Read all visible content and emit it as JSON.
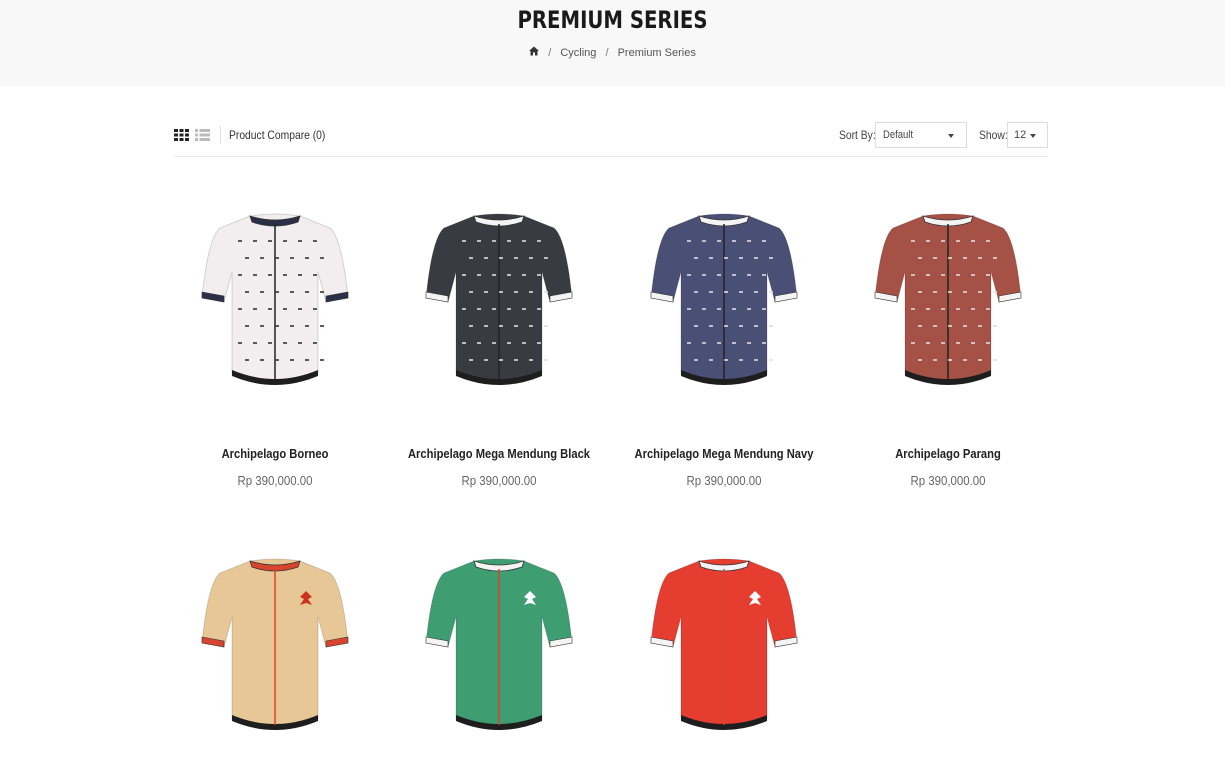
{
  "page": {
    "title": "PREMIUM SERIES",
    "breadcrumb": [
      "Cycling",
      "Premium Series"
    ],
    "breadcrumb_separator": "/"
  },
  "toolbar": {
    "compare_label": "Product Compare (0)",
    "sort_label": "Sort By:",
    "sort_value": "Default",
    "show_label": "Show:",
    "show_value": "12"
  },
  "products": [
    {
      "name": "Archipelago Borneo",
      "price": "Rp 390,000.00",
      "jersey_color": "#f2eef0",
      "accent": "#2c2f48"
    },
    {
      "name": "Archipelago Mega Mendung Black",
      "price": "Rp 390,000.00",
      "jersey_color": "#3a3b40",
      "accent": "#f4f4f4"
    },
    {
      "name": "Archipelago Mega Mendung Navy",
      "price": "Rp 390,000.00",
      "jersey_color": "#4a4f76",
      "accent": "#f4f4f4"
    },
    {
      "name": "Archipelago Parang",
      "price": "Rp 390,000.00",
      "jersey_color": "#a65145",
      "accent": "#f4f4f4"
    },
    {
      "name": "",
      "price": "",
      "jersey_color": "#e8c797",
      "accent": "#d9442f"
    },
    {
      "name": "",
      "price": "",
      "jersey_color": "#3f9d72",
      "accent": "#f4f4f4"
    },
    {
      "name": "",
      "price": "",
      "jersey_color": "#e53d30",
      "accent": "#f4f4f4"
    }
  ]
}
